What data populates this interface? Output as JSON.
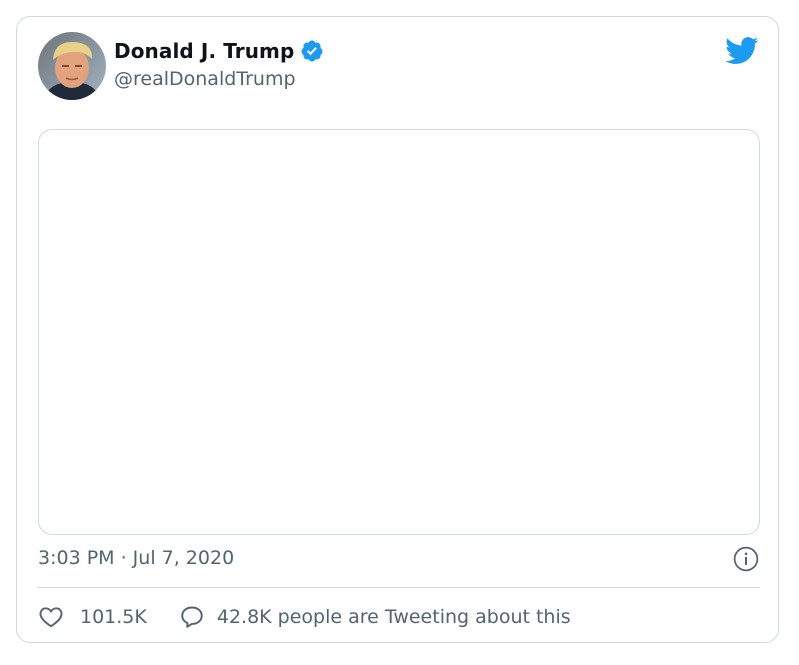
{
  "author": {
    "display_name": "Donald J. Trump",
    "handle": "@realDonaldTrump",
    "verified": true
  },
  "icons": {
    "verified": "verified-badge-icon",
    "logo": "twitter-bird-icon",
    "info": "info-icon",
    "like": "heart-icon",
    "reply": "speech-bubble-icon"
  },
  "tweet": {
    "timestamp": "3:03 PM · Jul 7, 2020"
  },
  "actions": {
    "likes": "101.5K",
    "conversation": "42.8K people are Tweeting about this"
  },
  "colors": {
    "brand_blue": "#1d9bf0",
    "text_primary": "#0f1419",
    "text_secondary": "#536471",
    "border": "#cfd9de"
  }
}
